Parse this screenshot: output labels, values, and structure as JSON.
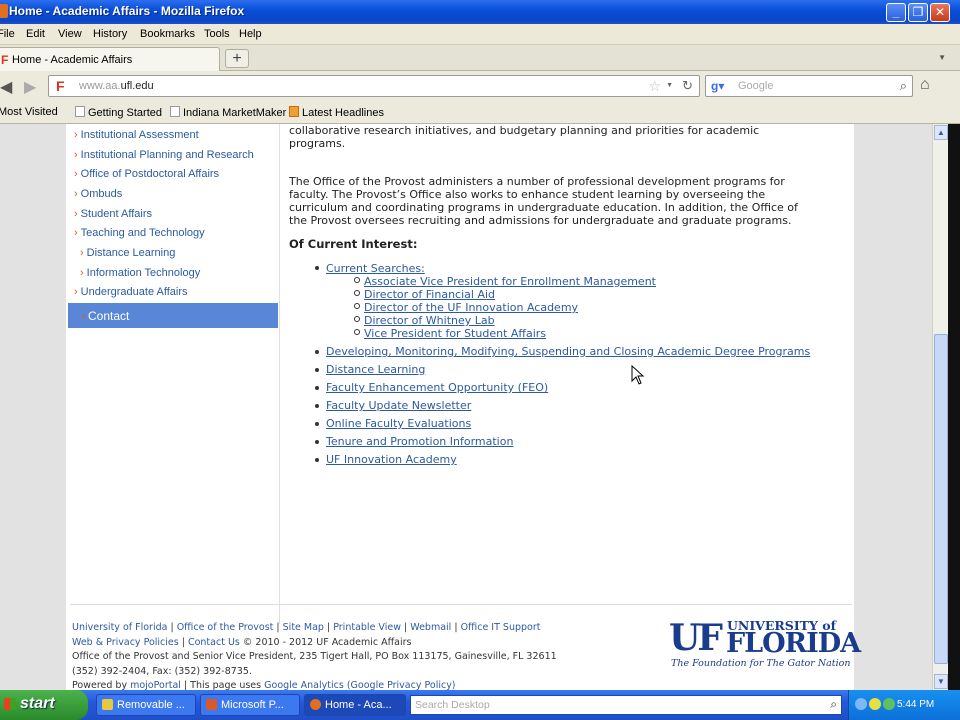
{
  "window": {
    "title": "Home - Academic Affairs - Mozilla Firefox",
    "min": "_",
    "max": "❐",
    "close": "✕"
  },
  "menu": [
    "File",
    "Edit",
    "View",
    "History",
    "Bookmarks",
    "Tools",
    "Help"
  ],
  "tab": {
    "title": "Home - Academic Affairs",
    "new_tab": "+"
  },
  "nav": {
    "url_prefix": "www.aa.",
    "url_main": "ufl.edu",
    "search_placeholder": "Google"
  },
  "bookmarks": [
    "Most Visited",
    "Getting Started",
    "Indiana MarketMaker",
    "Latest Headlines"
  ],
  "sidebar": {
    "items": [
      {
        "label": "Institutional Assessment",
        "sub": false
      },
      {
        "label": "Institutional Planning and Research",
        "sub": false
      },
      {
        "label": "Office of Postdoctoral Affairs",
        "sub": false
      },
      {
        "label": "Ombuds",
        "sub": false
      },
      {
        "label": "Student Affairs",
        "sub": false
      },
      {
        "label": "Teaching and Technology",
        "sub": false
      },
      {
        "label": "Distance Learning",
        "sub": true
      },
      {
        "label": "Information Technology",
        "sub": true
      },
      {
        "label": "Undergraduate Affairs",
        "sub": false
      }
    ],
    "contact": "Contact"
  },
  "main": {
    "para1_l1": "collaborative research initiatives, and budgetary planning and priorities for academic",
    "para1_l2": "programs.",
    "para2_l1": "The Office of the Provost administers a number of professional development programs for",
    "para2_l2": "faculty. The Provost’s Office also works to enhance student learning by overseeing the",
    "para2_l3": "curriculum and coordinating programs in undergraduate education.  In addition, the Office of",
    "para2_l4": "the Provost oversees recruiting and admissions for undergraduate and graduate programs.",
    "heading": "Of Current Interest:",
    "current_searches": "Current Searches:",
    "searches": [
      "Associate Vice President for Enrollment Management",
      "Director of Financial Aid",
      "Director of the UF Innovation Academy",
      "Director of Whitney Lab",
      "Vice President for Student Affairs"
    ],
    "links": [
      "Developing, Monitoring, Modifying, Suspending and Closing Academic Degree Programs",
      "Distance Learning",
      "Faculty Enhancement Opportunity (FEO)",
      "Faculty Update Newsletter",
      "Online Faculty Evaluations",
      "Tenure and Promotion Information",
      "UF Innovation Academy"
    ]
  },
  "footer": {
    "links1": [
      "University of Florida",
      "Office of the Provost",
      "Site Map",
      "Printable View",
      "Webmail",
      "Office IT Support"
    ],
    "web_privacy": "Web & Privacy Policies",
    "contact_us": "Contact Us",
    "copyright": "© 2010 - 2012 UF Academic Affairs",
    "address": "Office of the Provost and Senior Vice President, 235 Tigert Hall, PO Box 113175, Gainesville, FL 32611",
    "phone": "(352) 392-2404, Fax: (352) 392-8735.",
    "powered_prefix": "Powered by",
    "mojoportal": "mojoPortal",
    "uses": "This page uses",
    "ga": "Google Analytics",
    "gpp": "(Google Privacy Policy)",
    "logo_uf": "UF",
    "logo_univ": "UNIVERSITY of",
    "logo_florida": "FLORIDA",
    "logo_tag": "The Foundation for The Gator Nation"
  },
  "taskbar": {
    "start": "start",
    "tasks": [
      "Removable ...",
      "Microsoft P...",
      "Home - Aca..."
    ],
    "search_placeholder": "Search Desktop",
    "clock": "5:44 PM"
  }
}
